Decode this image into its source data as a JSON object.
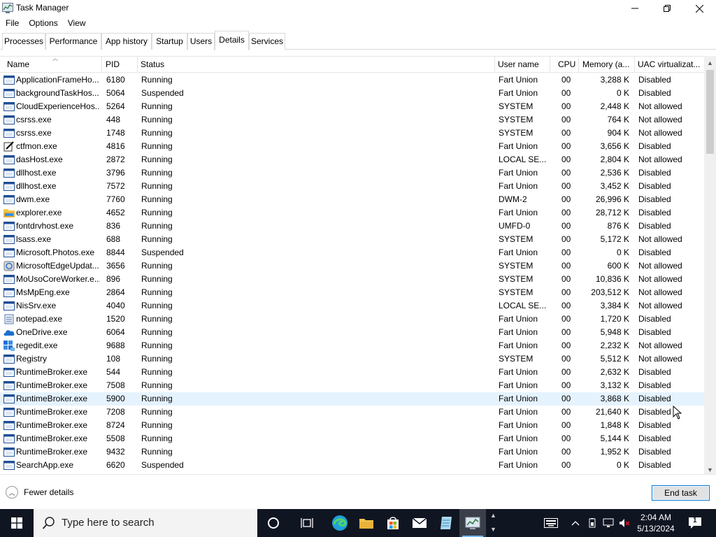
{
  "window": {
    "title": "Task Manager",
    "minimize_glyph": "—",
    "maximize_glyph": "❐",
    "close_glyph": "✕"
  },
  "menu": [
    "File",
    "Options",
    "View"
  ],
  "tabs": [
    {
      "label": "Processes",
      "active": false
    },
    {
      "label": "Performance",
      "active": false
    },
    {
      "label": "App history",
      "active": false
    },
    {
      "label": "Startup",
      "active": false
    },
    {
      "label": "Users",
      "active": false
    },
    {
      "label": "Details",
      "active": true
    },
    {
      "label": "Services",
      "active": false
    }
  ],
  "columns": [
    "Name",
    "PID",
    "Status",
    "User name",
    "CPU",
    "Memory (a...",
    "UAC virtualizat..."
  ],
  "rows": [
    {
      "icon": "app-frame-icon",
      "name": "ApplicationFrameHo...",
      "pid": "6180",
      "status": "Running",
      "user": "Fart Union",
      "cpu": "00",
      "mem": "3,288 K",
      "uac": "Disabled"
    },
    {
      "icon": "app-frame-icon",
      "name": "backgroundTaskHos...",
      "pid": "5064",
      "status": "Suspended",
      "user": "Fart Union",
      "cpu": "00",
      "mem": "0 K",
      "uac": "Disabled"
    },
    {
      "icon": "app-frame-icon",
      "name": "CloudExperienceHos...",
      "pid": "5264",
      "status": "Running",
      "user": "SYSTEM",
      "cpu": "00",
      "mem": "2,448 K",
      "uac": "Not allowed"
    },
    {
      "icon": "app-frame-icon",
      "name": "csrss.exe",
      "pid": "448",
      "status": "Running",
      "user": "SYSTEM",
      "cpu": "00",
      "mem": "764 K",
      "uac": "Not allowed"
    },
    {
      "icon": "app-frame-icon",
      "name": "csrss.exe",
      "pid": "1748",
      "status": "Running",
      "user": "SYSTEM",
      "cpu": "00",
      "mem": "904 K",
      "uac": "Not allowed"
    },
    {
      "icon": "pen-icon",
      "name": "ctfmon.exe",
      "pid": "4816",
      "status": "Running",
      "user": "Fart Union",
      "cpu": "00",
      "mem": "3,656 K",
      "uac": "Disabled"
    },
    {
      "icon": "app-frame-icon",
      "name": "dasHost.exe",
      "pid": "2872",
      "status": "Running",
      "user": "LOCAL SE...",
      "cpu": "00",
      "mem": "2,804 K",
      "uac": "Not allowed"
    },
    {
      "icon": "app-frame-icon",
      "name": "dllhost.exe",
      "pid": "3796",
      "status": "Running",
      "user": "Fart Union",
      "cpu": "00",
      "mem": "2,536 K",
      "uac": "Disabled"
    },
    {
      "icon": "app-frame-icon",
      "name": "dllhost.exe",
      "pid": "7572",
      "status": "Running",
      "user": "Fart Union",
      "cpu": "00",
      "mem": "3,452 K",
      "uac": "Disabled"
    },
    {
      "icon": "app-frame-icon",
      "name": "dwm.exe",
      "pid": "7760",
      "status": "Running",
      "user": "DWM-2",
      "cpu": "00",
      "mem": "26,996 K",
      "uac": "Disabled"
    },
    {
      "icon": "folder-icon",
      "name": "explorer.exe",
      "pid": "4652",
      "status": "Running",
      "user": "Fart Union",
      "cpu": "00",
      "mem": "28,712 K",
      "uac": "Disabled"
    },
    {
      "icon": "app-frame-icon",
      "name": "fontdrvhost.exe",
      "pid": "836",
      "status": "Running",
      "user": "UMFD-0",
      "cpu": "00",
      "mem": "876 K",
      "uac": "Disabled"
    },
    {
      "icon": "app-frame-icon",
      "name": "lsass.exe",
      "pid": "688",
      "status": "Running",
      "user": "SYSTEM",
      "cpu": "00",
      "mem": "5,172 K",
      "uac": "Not allowed"
    },
    {
      "icon": "app-frame-icon",
      "name": "Microsoft.Photos.exe",
      "pid": "8844",
      "status": "Suspended",
      "user": "Fart Union",
      "cpu": "00",
      "mem": "0 K",
      "uac": "Disabled"
    },
    {
      "icon": "updater-icon",
      "name": "MicrosoftEdgeUpdat...",
      "pid": "3656",
      "status": "Running",
      "user": "SYSTEM",
      "cpu": "00",
      "mem": "600 K",
      "uac": "Not allowed"
    },
    {
      "icon": "app-frame-icon",
      "name": "MoUsoCoreWorker.e...",
      "pid": "896",
      "status": "Running",
      "user": "SYSTEM",
      "cpu": "00",
      "mem": "10,836 K",
      "uac": "Not allowed"
    },
    {
      "icon": "app-frame-icon",
      "name": "MsMpEng.exe",
      "pid": "2864",
      "status": "Running",
      "user": "SYSTEM",
      "cpu": "00",
      "mem": "203,512 K",
      "uac": "Not allowed"
    },
    {
      "icon": "app-frame-icon",
      "name": "NisSrv.exe",
      "pid": "4040",
      "status": "Running",
      "user": "LOCAL SE...",
      "cpu": "00",
      "mem": "3,384 K",
      "uac": "Not allowed"
    },
    {
      "icon": "notepad-icon",
      "name": "notepad.exe",
      "pid": "1520",
      "status": "Running",
      "user": "Fart Union",
      "cpu": "00",
      "mem": "1,720 K",
      "uac": "Disabled"
    },
    {
      "icon": "onedrive-icon",
      "name": "OneDrive.exe",
      "pid": "6064",
      "status": "Running",
      "user": "Fart Union",
      "cpu": "00",
      "mem": "5,948 K",
      "uac": "Disabled"
    },
    {
      "icon": "regedit-icon",
      "name": "regedit.exe",
      "pid": "9688",
      "status": "Running",
      "user": "Fart Union",
      "cpu": "00",
      "mem": "2,232 K",
      "uac": "Not allowed"
    },
    {
      "icon": "app-frame-icon",
      "name": "Registry",
      "pid": "108",
      "status": "Running",
      "user": "SYSTEM",
      "cpu": "00",
      "mem": "5,512 K",
      "uac": "Not allowed"
    },
    {
      "icon": "app-frame-icon",
      "name": "RuntimeBroker.exe",
      "pid": "544",
      "status": "Running",
      "user": "Fart Union",
      "cpu": "00",
      "mem": "2,632 K",
      "uac": "Disabled"
    },
    {
      "icon": "app-frame-icon",
      "name": "RuntimeBroker.exe",
      "pid": "7508",
      "status": "Running",
      "user": "Fart Union",
      "cpu": "00",
      "mem": "3,132 K",
      "uac": "Disabled"
    },
    {
      "icon": "app-frame-icon",
      "name": "RuntimeBroker.exe",
      "pid": "5900",
      "status": "Running",
      "user": "Fart Union",
      "cpu": "00",
      "mem": "3,868 K",
      "uac": "Disabled",
      "hover": true
    },
    {
      "icon": "app-frame-icon",
      "name": "RuntimeBroker.exe",
      "pid": "7208",
      "status": "Running",
      "user": "Fart Union",
      "cpu": "00",
      "mem": "21,640 K",
      "uac": "Disabled"
    },
    {
      "icon": "app-frame-icon",
      "name": "RuntimeBroker.exe",
      "pid": "8724",
      "status": "Running",
      "user": "Fart Union",
      "cpu": "00",
      "mem": "1,848 K",
      "uac": "Disabled"
    },
    {
      "icon": "app-frame-icon",
      "name": "RuntimeBroker.exe",
      "pid": "5508",
      "status": "Running",
      "user": "Fart Union",
      "cpu": "00",
      "mem": "5,144 K",
      "uac": "Disabled"
    },
    {
      "icon": "app-frame-icon",
      "name": "RuntimeBroker.exe",
      "pid": "9432",
      "status": "Running",
      "user": "Fart Union",
      "cpu": "00",
      "mem": "1,952 K",
      "uac": "Disabled"
    },
    {
      "icon": "app-frame-icon",
      "name": "SearchApp.exe",
      "pid": "6620",
      "status": "Suspended",
      "user": "Fart Union",
      "cpu": "00",
      "mem": "0 K",
      "uac": "Disabled"
    }
  ],
  "footer": {
    "fewer_details": "Fewer details",
    "end_task": "End task"
  },
  "taskbar": {
    "search_placeholder": "Type here to search",
    "time": "2:04 AM",
    "date": "5/13/2024",
    "pinned": [
      "cortana-icon",
      "task-view-icon",
      "edge-icon",
      "file-explorer-icon",
      "store-icon",
      "mail-icon",
      "notepad-icon",
      "task-manager-icon"
    ],
    "tray": [
      "keyboard-icon",
      "chevron-up-icon",
      "battery-icon",
      "network-icon",
      "volume-muted-icon",
      "notification-icon"
    ],
    "notification_count": "1"
  },
  "colors": {
    "accent": "#0078d7",
    "row_hover": "#e5f3ff",
    "taskbar": "#101522"
  }
}
